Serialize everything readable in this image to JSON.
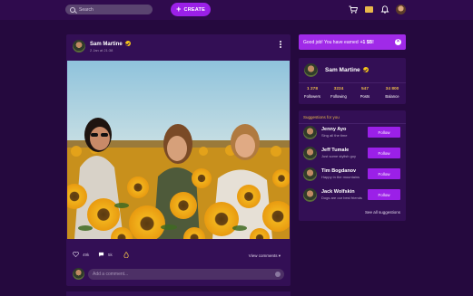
{
  "topbar": {
    "search_placeholder": "Search",
    "create_label": "CREATE",
    "icons": [
      "search-icon",
      "plus-icon",
      "cart-icon",
      "ticket-icon",
      "bell-icon",
      "avatar"
    ]
  },
  "post": {
    "author": "Sam Martine",
    "date": "2 Jan at 21:38",
    "likes": "49k",
    "comments": "5k",
    "view_comments": "View comments",
    "comment_placeholder": "Add a comment..."
  },
  "notification": {
    "text": "Good job! You have earned",
    "reward": "+1 $B!"
  },
  "profile": {
    "name": "Sam Martine",
    "stats": [
      {
        "value": "1 278",
        "label": "Followers"
      },
      {
        "value": "3224",
        "label": "Following"
      },
      {
        "value": "547",
        "label": "Posts"
      },
      {
        "value": "34 800",
        "label": "Balance"
      }
    ]
  },
  "suggestions": {
    "title": "Suggestions for you",
    "follow_label": "Follow",
    "see_all": "See all suggestions",
    "items": [
      {
        "name": "Jenny Ayo",
        "subtitle": "Sing all the time"
      },
      {
        "name": "Jeff Tumale",
        "subtitle": "Just some stylish guy"
      },
      {
        "name": "Tim Bogdanov",
        "subtitle": "Happy in the mountains"
      },
      {
        "name": "Jack Wolfskin",
        "subtitle": "Dogs are our best friends"
      }
    ]
  },
  "colors": {
    "background": "#25093e",
    "card": "#330f55",
    "accent": "#9b20e8",
    "gold": "#e8b84a"
  }
}
